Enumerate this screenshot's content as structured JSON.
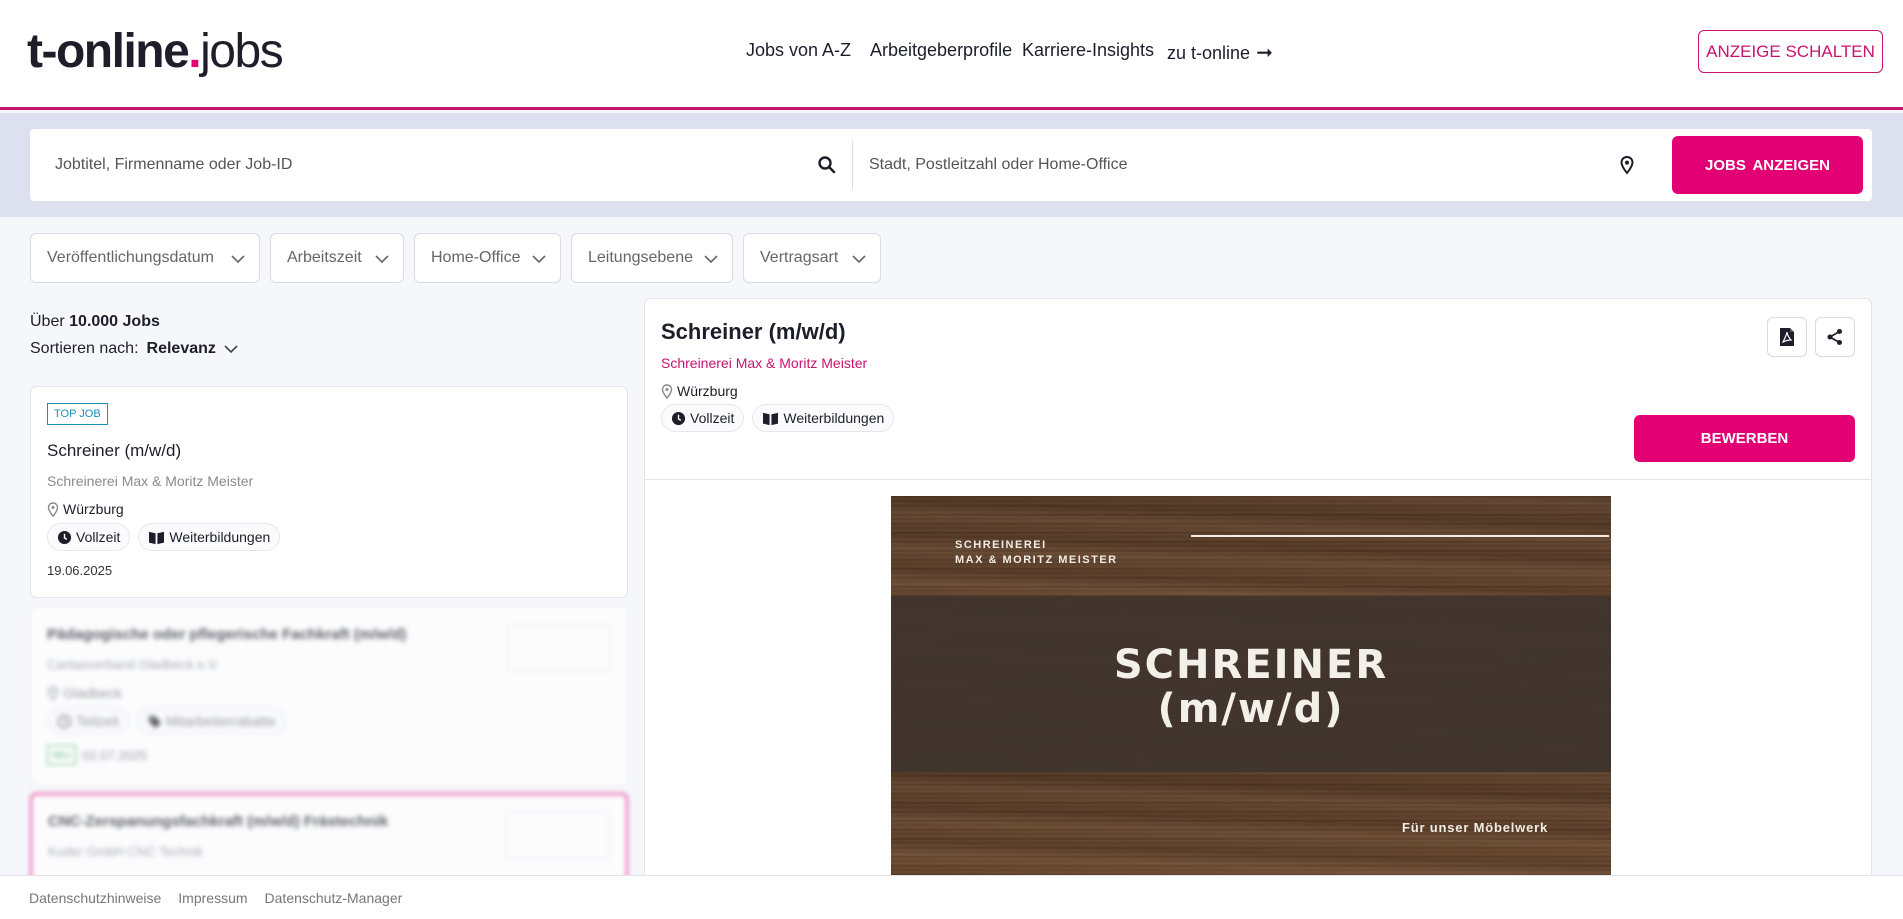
{
  "brand": {
    "part1": "t-online",
    "dot": ".",
    "part2": "jobs",
    "accent": "#e20074"
  },
  "nav": [
    {
      "label": "Jobs von A-Z"
    },
    {
      "label": "Arbeitgeberprofile"
    },
    {
      "label": "Karriere-Insights"
    },
    {
      "label": "zu t-online",
      "icon": "arrow-right-icon"
    }
  ],
  "header_cta": "ANZEIGE SCHALTEN",
  "search": {
    "what_placeholder": "Jobtitel, Firmenname oder Job-ID",
    "where_placeholder": "Stadt, Postleitzahl oder Home-Office",
    "button": "JOBS  ANZEIGEN"
  },
  "filters": [
    {
      "label": "Veröffentlichungsdatum"
    },
    {
      "label": "Arbeitszeit"
    },
    {
      "label": "Home-Office"
    },
    {
      "label": "Leitungsebene"
    },
    {
      "label": "Vertragsart"
    }
  ],
  "results": {
    "prefix": "Über",
    "count": "10.000",
    "suffix": "Jobs",
    "sort_label": "Sortieren nach:",
    "sort_value": "Relevanz"
  },
  "jobs": [
    {
      "badge": "TOP JOB",
      "title": "Schreiner (m/w/d)",
      "company": "Schreinerei Max & Moritz Meister",
      "location": "Würzburg",
      "tags": [
        "Vollzeit",
        "Weiterbildungen"
      ],
      "date": "19.06.2025"
    },
    {
      "title": "Pädagogische oder pflegerische Fachkraft (m/w/d)",
      "company": "Caritasverband Gladbeck e.V.",
      "location": "Gladbeck",
      "tags": [
        "Teilzeit",
        "Mitarbeiterrabatte"
      ],
      "badge": "NEU",
      "date": "02.07.2025"
    },
    {
      "title": "CNC-Zerspanungsfachkraft (m/w/d) Frästechnik",
      "company": "Kuder GmbH CNC Technik"
    }
  ],
  "detail": {
    "title": "Schreiner (m/w/d)",
    "company": "Schreinerei Max & Moritz Meister",
    "location": "Würzburg",
    "tags": [
      "Vollzeit",
      "Weiterbildungen"
    ],
    "apply": "BEWERBEN",
    "banner": {
      "brand_line1": "SCHREINEREI",
      "brand_line2": "MAX & MORITZ MEISTER",
      "headline_line1": "SCHREINER",
      "headline_line2": "(m/w/d)",
      "subline": "Für unser Möbelwerk"
    }
  },
  "footer": [
    "Datenschutzhinweise",
    "Impressum",
    "Datenschutz-Manager"
  ]
}
